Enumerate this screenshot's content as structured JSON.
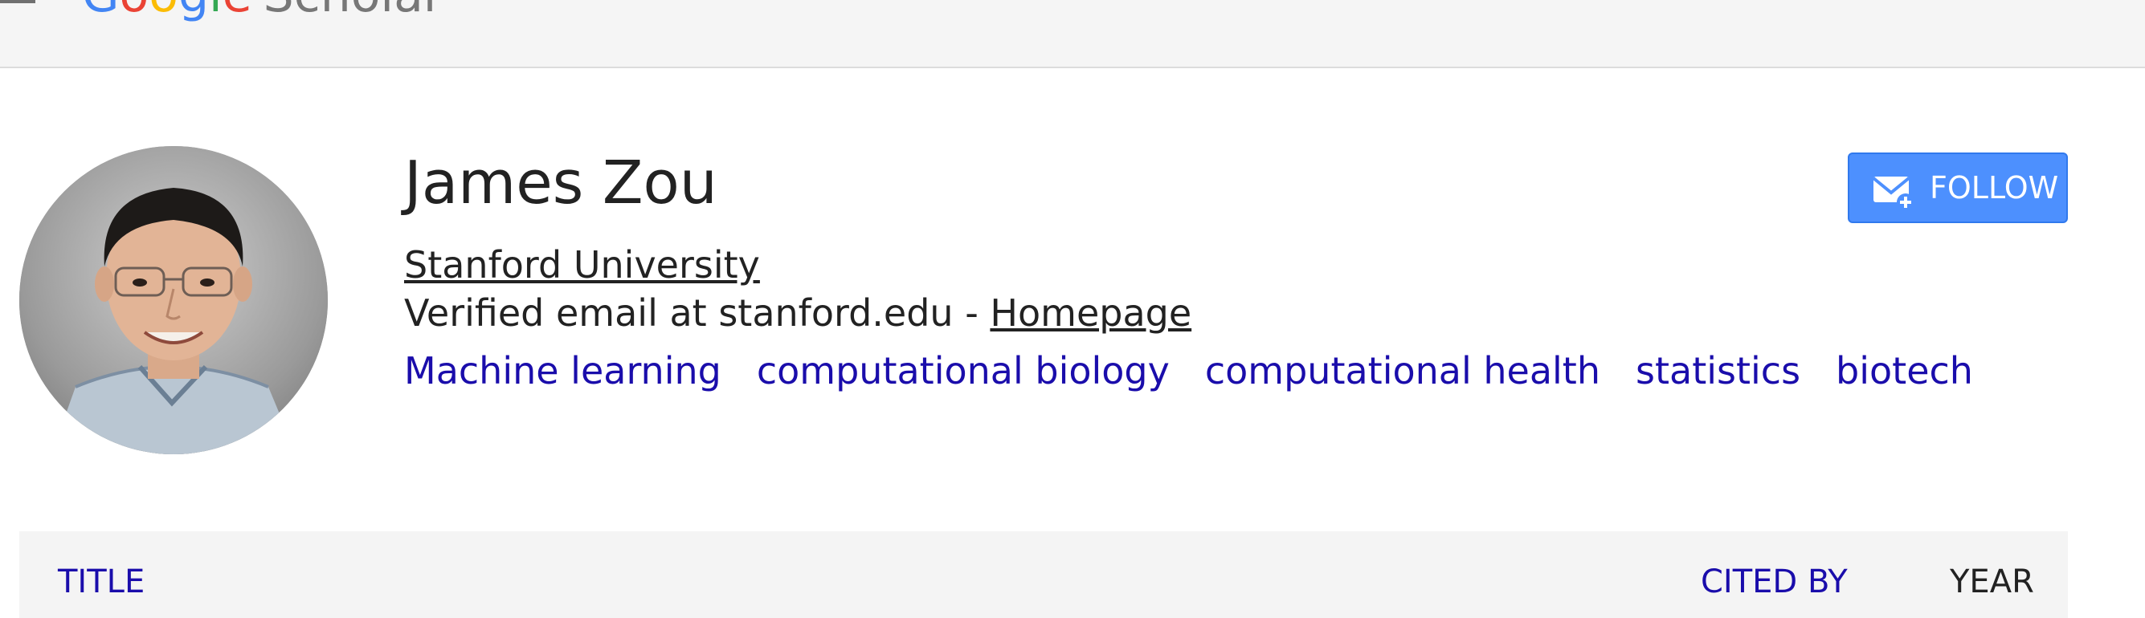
{
  "header": {
    "logo": {
      "letters": [
        "G",
        "o",
        "o",
        "g",
        "l",
        "e"
      ],
      "product": "Scholar"
    }
  },
  "profile": {
    "name": "James Zou",
    "affiliation": "Stanford University",
    "email_text": "Verified email at stanford.edu - ",
    "homepage_label": "Homepage",
    "interests": [
      "Machine learning",
      "computational biology",
      "computational health",
      "statistics",
      "biotech"
    ],
    "follow_label": "FOLLOW"
  },
  "table": {
    "title_header": "TITLE",
    "cited_by_header": "CITED BY",
    "year_header": "YEAR"
  },
  "colors": {
    "link_blue": "#1a0dab",
    "follow_button": "#4d90fe",
    "topbar_bg": "#f5f5f5"
  },
  "icons": {
    "menu": "hamburger-menu-icon",
    "follow": "mail-plus-icon"
  }
}
